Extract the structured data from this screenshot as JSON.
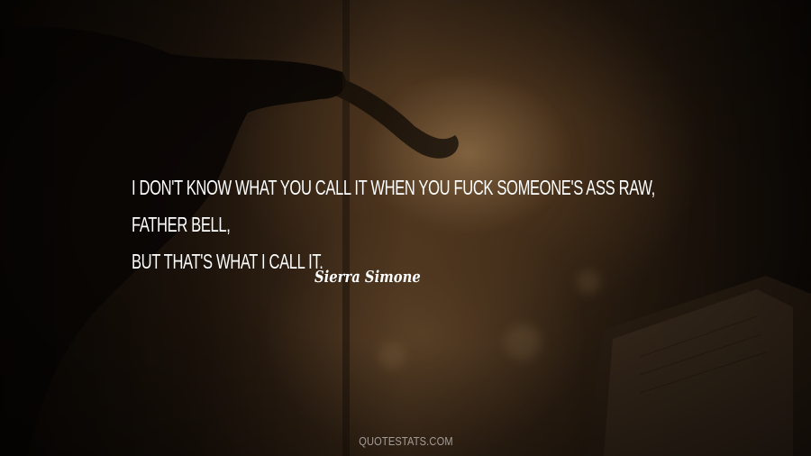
{
  "quote": {
    "line1": "I don't know what you call it when you fuck someone's ass raw, Father Bell,",
    "line2": "but that's what I call it."
  },
  "author": "Sierra Simone",
  "watermark": "QUOTESTATS.COM",
  "colors": {
    "text": "#ffffff",
    "background_dark": "#1a120b",
    "background_warm": "#c4965f"
  }
}
